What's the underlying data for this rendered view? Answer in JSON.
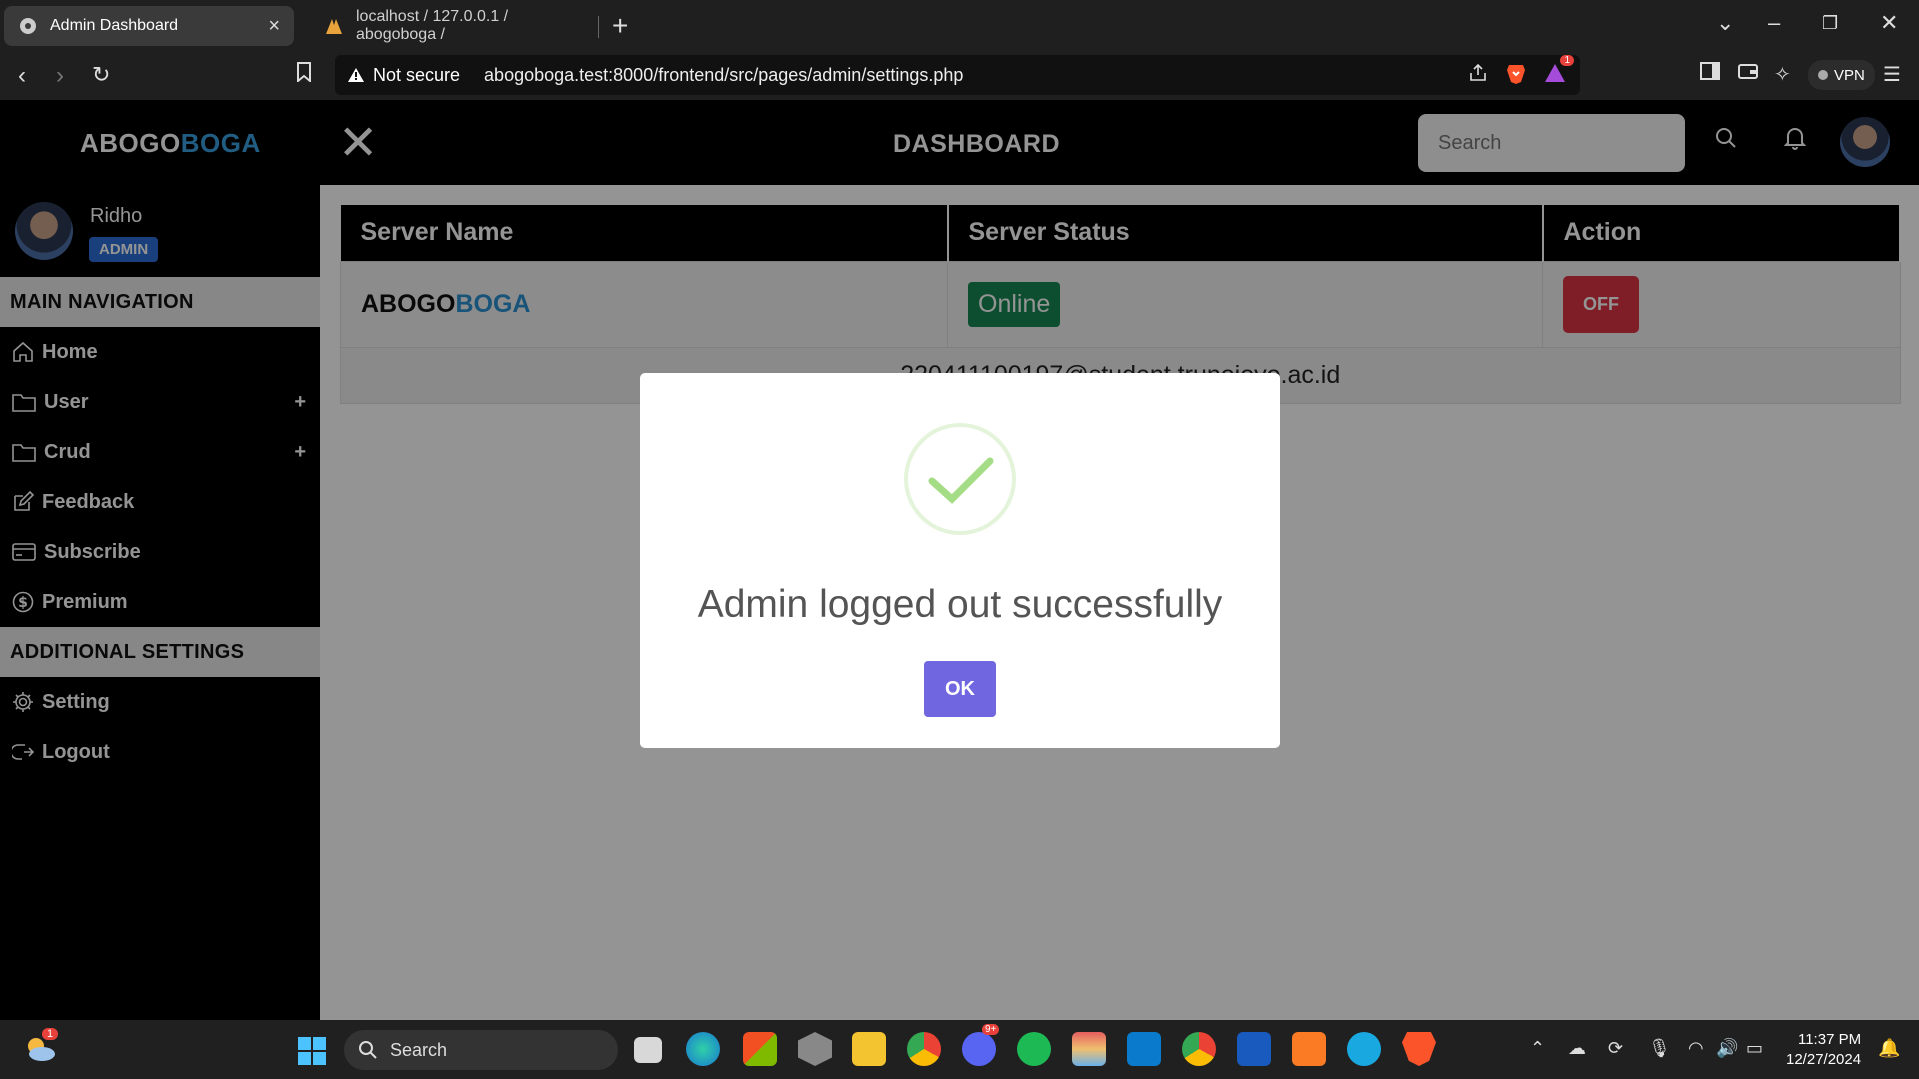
{
  "browser": {
    "tabs": [
      {
        "label": "Admin Dashboard",
        "active": true
      },
      {
        "label": "localhost / 127.0.0.1 / abogoboga /",
        "active": false
      }
    ],
    "address": {
      "security": "Not secure",
      "url": "abogoboga.test:8000/frontend/src/pages/admin/settings.php"
    },
    "vpn_label": "VPN",
    "notification_count": "1"
  },
  "header": {
    "brand_part1": "ABOGO",
    "brand_part2": "BOGA",
    "title": "DASHBOARD",
    "search_placeholder": "Search"
  },
  "sidebar": {
    "user_name": "Ridho",
    "user_role": "ADMIN",
    "main_section": "MAIN NAVIGATION",
    "nav_items": [
      {
        "label": "Home",
        "icon": "home-icon",
        "expandable": false
      },
      {
        "label": "User",
        "icon": "folder-icon",
        "expandable": true
      },
      {
        "label": "Crud",
        "icon": "folder-icon",
        "expandable": true
      },
      {
        "label": "Feedback",
        "icon": "edit-icon",
        "expandable": false
      },
      {
        "label": "Subscribe",
        "icon": "card-icon",
        "expandable": false
      },
      {
        "label": "Premium",
        "icon": "dollar-icon",
        "expandable": false
      }
    ],
    "additional_section": "ADDITIONAL SETTINGS",
    "settings_items": [
      {
        "label": "Setting",
        "icon": "gear-icon"
      },
      {
        "label": "Logout",
        "icon": "logout-icon"
      }
    ],
    "plus_symbol": "+"
  },
  "table": {
    "headers": [
      "Server Name",
      "Server Status",
      "Action"
    ],
    "row": {
      "server_name_part1": "ABOGO",
      "server_name_part2": "BOGA",
      "status": "Online",
      "action": "OFF"
    },
    "footer_text": "220411100197@student.trunojoyo.ac.id"
  },
  "modal": {
    "title": "Admin logged out successfully",
    "button": "OK"
  },
  "taskbar": {
    "search_label": "Search",
    "time": "11:37 PM",
    "date": "12/27/2024",
    "weather_badge": "1",
    "discord_badge": "9+"
  },
  "colors": {
    "accent_blue": "#3aa0e0",
    "online_green": "#198754",
    "off_red": "#dc3545",
    "ok_purple": "#7066e0",
    "success_check": "#a5dc86"
  }
}
